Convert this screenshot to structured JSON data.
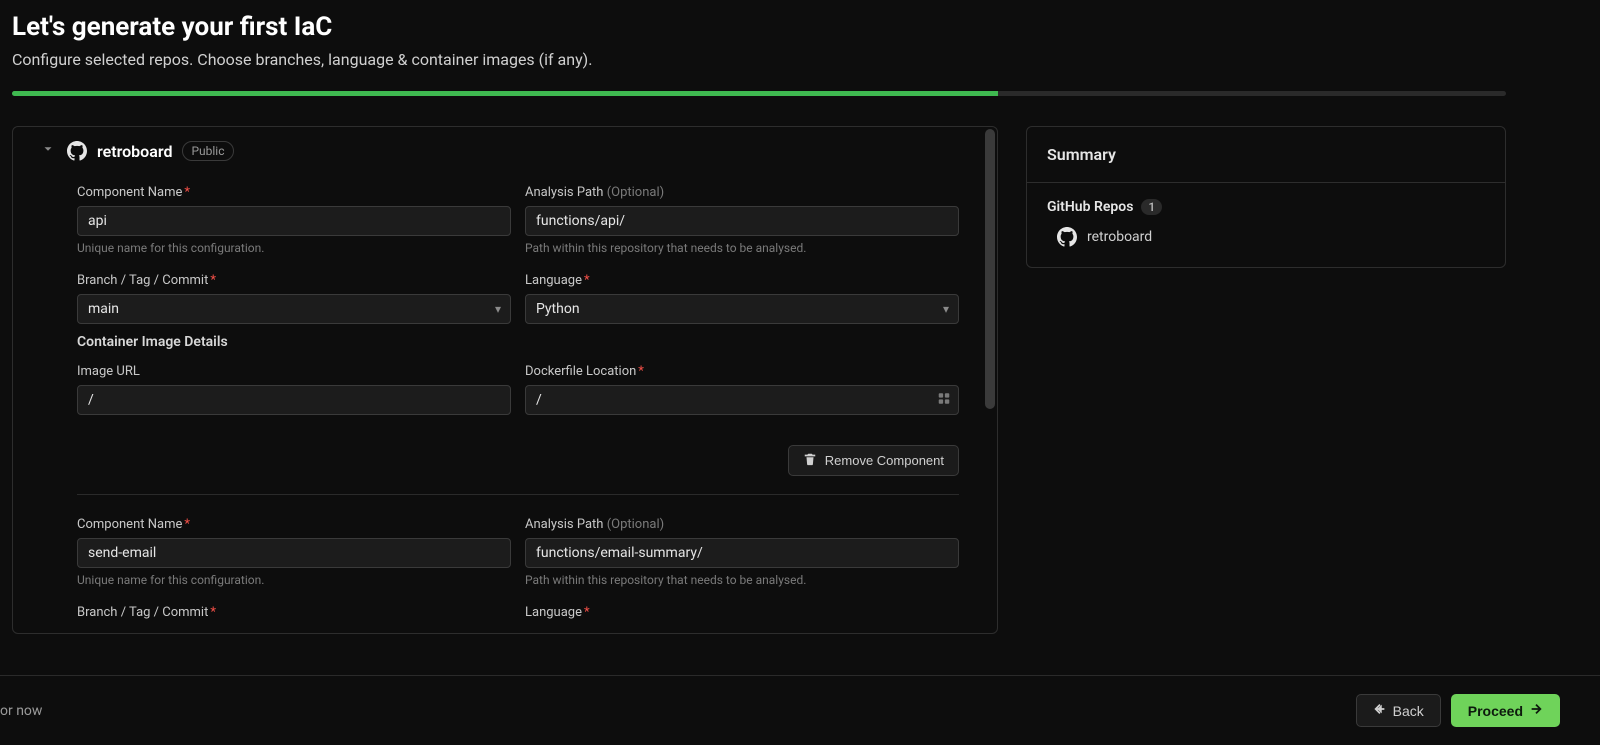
{
  "header": {
    "title": "Let's generate your first IaC",
    "subtitle": "Configure selected repos. Choose branches, language & container images (if any)."
  },
  "progress": {
    "percent": 66
  },
  "repo": {
    "name": "retroboard",
    "visibility": "Public"
  },
  "labels": {
    "component_name": "Component Name",
    "analysis_path": "Analysis Path",
    "optional": "(Optional)",
    "branch": "Branch / Tag / Commit",
    "language": "Language",
    "container_section": "Container Image Details",
    "image_url": "Image URL",
    "dockerfile": "Dockerfile Location",
    "helper_name": "Unique name for this configuration.",
    "helper_path": "Path within this repository that needs to be analysed.",
    "remove": "Remove Component"
  },
  "components": [
    {
      "name": "api",
      "analysis_path": "functions/api/",
      "branch": "main",
      "language": "Python",
      "image_url": "/",
      "dockerfile": "/"
    },
    {
      "name": "send-email",
      "analysis_path": "functions/email-summary/",
      "branch": "",
      "language": ""
    }
  ],
  "summary": {
    "title": "Summary",
    "section_label": "GitHub Repos",
    "count": "1",
    "items": [
      "retroboard"
    ]
  },
  "footer": {
    "skip": "or now",
    "back": "Back",
    "proceed": "Proceed"
  }
}
